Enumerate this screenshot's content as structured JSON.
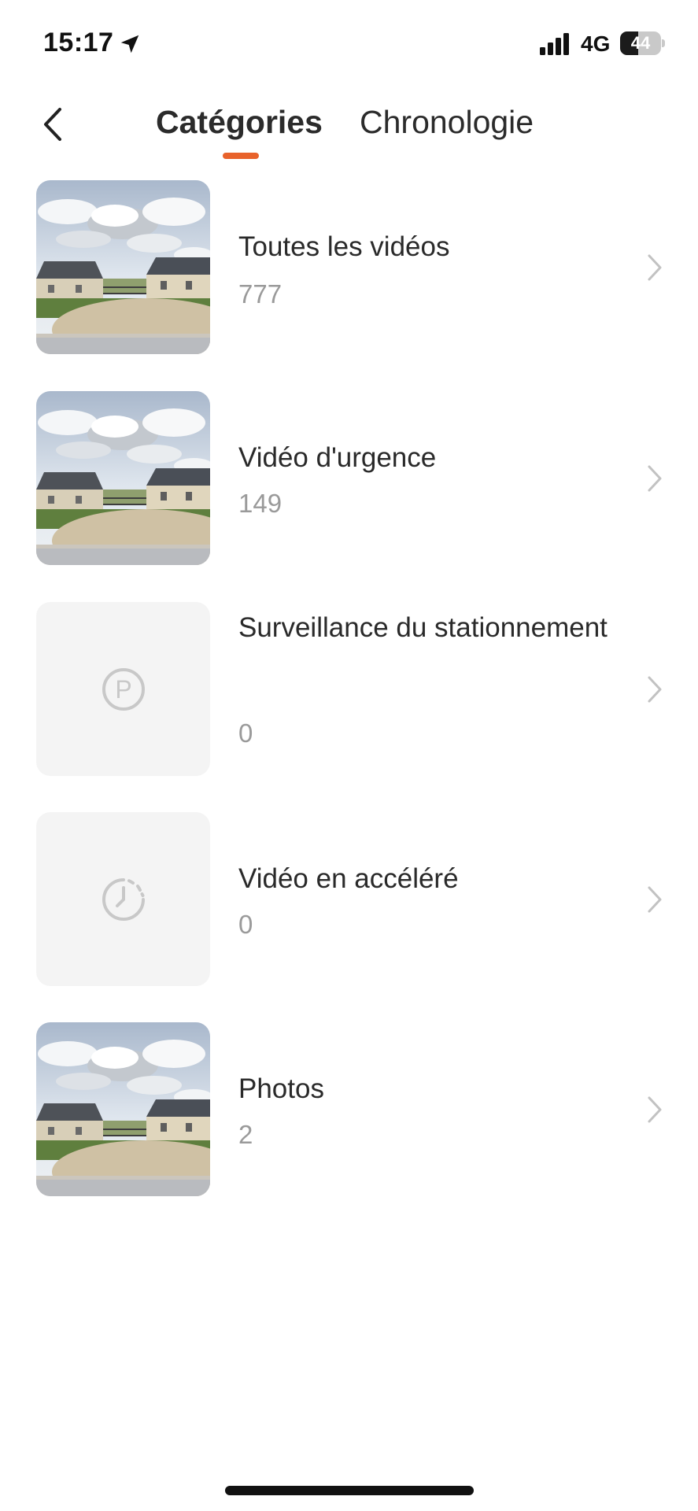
{
  "status_bar": {
    "time": "15:17",
    "network": "4G",
    "battery_level": "44",
    "icons": [
      "location-arrow-icon",
      "signal-icon",
      "battery-icon"
    ]
  },
  "header": {
    "back_icon": "chevron-left-icon",
    "tabs": [
      {
        "label": "Catégories",
        "active": true
      },
      {
        "label": "Chronologie",
        "active": false
      }
    ],
    "accent_color": "#e8622b"
  },
  "categories": [
    {
      "label": "Toutes les vidéos",
      "count": "777",
      "thumbnail": "photo"
    },
    {
      "label": "Vidéo d'urgence",
      "count": "149",
      "thumbnail": "photo"
    },
    {
      "label": "Surveillance du stationnement",
      "count": "0",
      "thumbnail": "parking-icon"
    },
    {
      "label": "Vidéo en accéléré",
      "count": "0",
      "thumbnail": "timelapse-icon"
    },
    {
      "label": "Photos",
      "count": "2",
      "thumbnail": "photo"
    }
  ]
}
